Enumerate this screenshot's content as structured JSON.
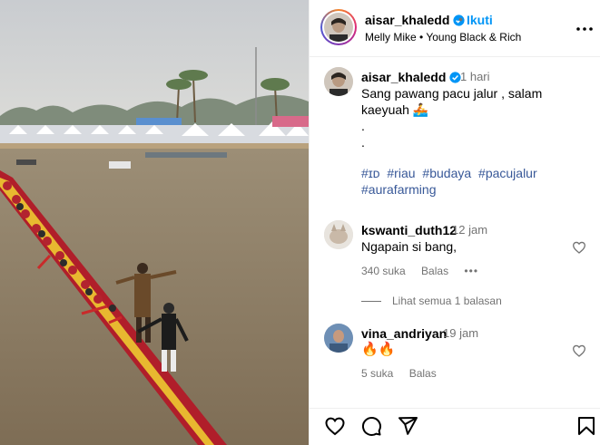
{
  "post": {
    "username": "aisar_khaledd",
    "follow_label": "Ikuti",
    "dot": "•",
    "audio": "Melly Mike • Young Black & Rich"
  },
  "caption": {
    "username": "aisar_khaledd",
    "time": "1 hari",
    "text": "Sang pawang pacu jalur , salam kaeyuah 🚣\n.\n.",
    "hashtags": [
      "#ɪᴅ",
      "#riau",
      "#budaya",
      "#pacujalur",
      "#aurafarming"
    ]
  },
  "comments": [
    {
      "username": "kswanti_duth12",
      "time": "12 jam",
      "text": "Ngapain si bang,",
      "likes": "340 suka",
      "reply": "Balas",
      "more": "•••",
      "view_replies": "Lihat semua 1 balasan"
    },
    {
      "username": "vina_andriyan",
      "time": "19 jam",
      "text": "🔥🔥",
      "likes": "5 suka",
      "reply": "Balas"
    }
  ],
  "icons": {
    "verified": "verified-badge-icon",
    "more": "more-options-icon",
    "like": "heart-icon",
    "comment": "comment-icon",
    "share": "share-icon",
    "save": "bookmark-icon"
  },
  "colors": {
    "accent": "#0095f6",
    "verified": "#0095f6",
    "secondary_text": "#737373",
    "hashtag": "#00376b"
  }
}
